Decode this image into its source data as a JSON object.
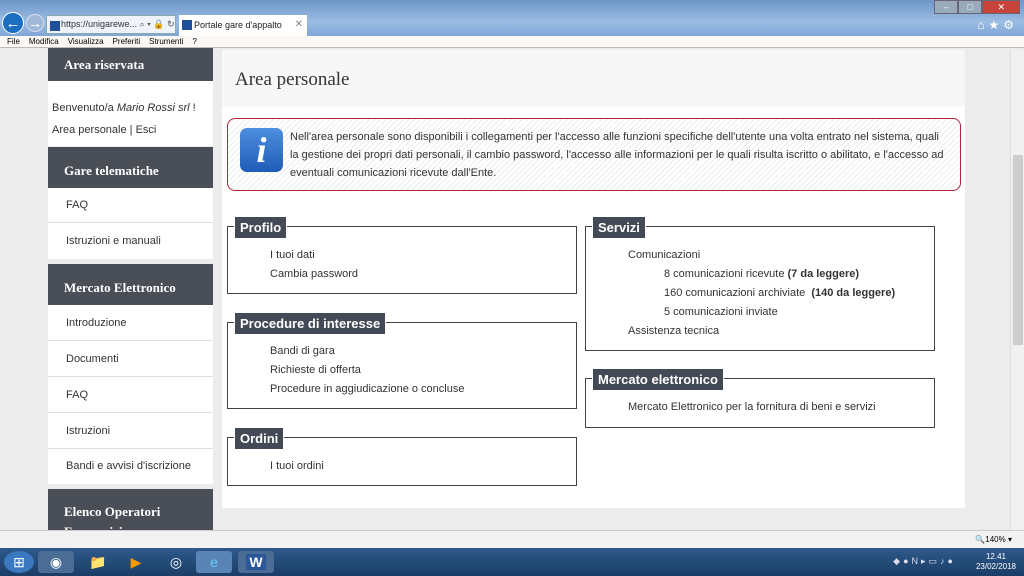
{
  "browser": {
    "address": "https://unigarewe...",
    "tab_title": "Portale gare d'appalto",
    "menu": [
      "File",
      "Modifica",
      "Visualizza",
      "Preferiti",
      "Strumenti",
      "?"
    ],
    "zoom": "140%"
  },
  "sidebar": {
    "reserved_title": "Area riservata",
    "welcome": "Benvenuto/a ",
    "user": "Mario Rossi srl",
    "welcome_end": " !",
    "personal_area": "Area personale",
    "sep": " | ",
    "logout": "Esci",
    "gare_title": "Gare telematiche",
    "gare_items": [
      "FAQ",
      "Istruzioni e manuali"
    ],
    "mercato_title": "Mercato Elettronico",
    "mercato_items": [
      "Introduzione",
      "Documenti",
      "FAQ",
      "Istruzioni",
      "Bandi e avvisi d'iscrizione"
    ],
    "elenco_title": "Elenco Operatori Economici"
  },
  "main": {
    "title": "Area personale",
    "info": "Nell'area personale sono disponibili i collegamenti per l'accesso alle funzioni specifiche dell'utente una volta entrato nel sistema, quali la gestione dei propri dati personali, il cambio password, l'accesso alle informazioni per le quali risulta iscritto o abilitato, e l'accesso ad eventuali comunicazioni ricevute dall'Ente.",
    "profilo": {
      "title": "Profilo",
      "items": [
        "I tuoi dati",
        "Cambia password"
      ]
    },
    "procedure": {
      "title": "Procedure di interesse",
      "items": [
        "Bandi di gara",
        "Richieste di offerta",
        "Procedure in aggiudicazione o concluse"
      ]
    },
    "ordini": {
      "title": "Ordini",
      "items": [
        "I tuoi ordini"
      ]
    },
    "servizi": {
      "title": "Servizi",
      "comunicazioni": "Comunicazioni",
      "ricevute": "8 comunicazioni ricevute ",
      "ricevute_unread": "(7 da leggere)",
      "archiviate": "160 comunicazioni archiviate  ",
      "archiviate_unread": "(140 da leggere)",
      "inviate": "5 comunicazioni inviate",
      "assistenza": "Assistenza tecnica"
    },
    "mercato": {
      "title": "Mercato elettronico",
      "items": [
        "Mercato Elettronico per la fornitura di beni e servizi"
      ]
    }
  },
  "taskbar": {
    "time": "12.41",
    "date": "23/02/2018"
  }
}
